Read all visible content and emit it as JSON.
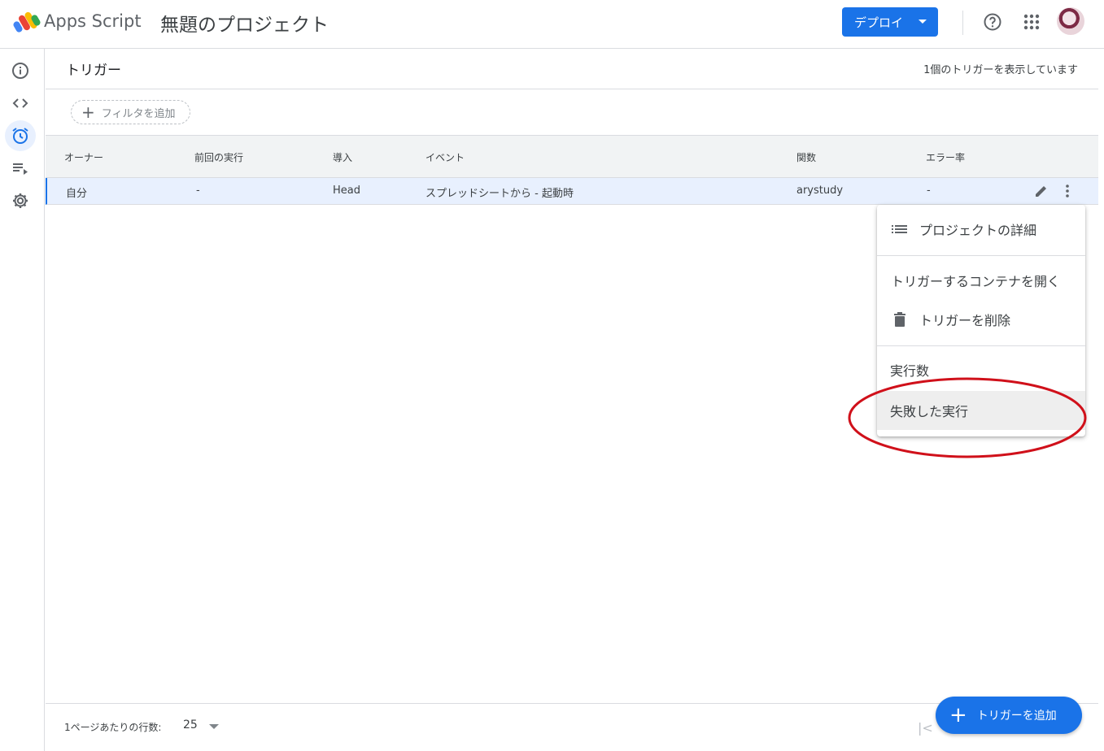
{
  "header": {
    "brand": "Apps Script",
    "project_title": "無題のプロジェクト",
    "deploy_label": "デプロイ"
  },
  "sidebar": {
    "items": [
      {
        "name": "overview",
        "icon": "info-icon"
      },
      {
        "name": "editor",
        "icon": "code-icon"
      },
      {
        "name": "triggers",
        "icon": "alarm-icon",
        "active": true
      },
      {
        "name": "executions",
        "icon": "executions-icon"
      },
      {
        "name": "settings",
        "icon": "gear-icon"
      }
    ]
  },
  "main": {
    "title": "トリガー",
    "count_text": "1個のトリガーを表示しています",
    "filter_label": "フィルタを追加",
    "columns": [
      "オーナー",
      "前回の実行",
      "導入",
      "イベント",
      "関数",
      "エラー率"
    ],
    "rows": [
      [
        "自分",
        "-",
        "Head",
        "スプレッドシートから - 起動時",
        "arystudy",
        "-"
      ]
    ]
  },
  "menu": {
    "items": [
      {
        "label": "プロジェクトの詳細",
        "icon": "list-icon"
      },
      {
        "label": "トリガーするコンテナを開く"
      },
      {
        "label": "トリガーを削除",
        "icon": "trash-icon"
      },
      {
        "label": "実行数"
      },
      {
        "label": "失敗した実行",
        "highlighted": true
      }
    ]
  },
  "footer": {
    "rows_per_page_label": "1ページあたりの行数:",
    "rows_per_page_value": "25",
    "add_trigger_label": "トリガーを追加"
  },
  "colors": {
    "primary": "#1a73e8",
    "active_bg": "#e8f0fe",
    "annotation": "#d0101a"
  }
}
